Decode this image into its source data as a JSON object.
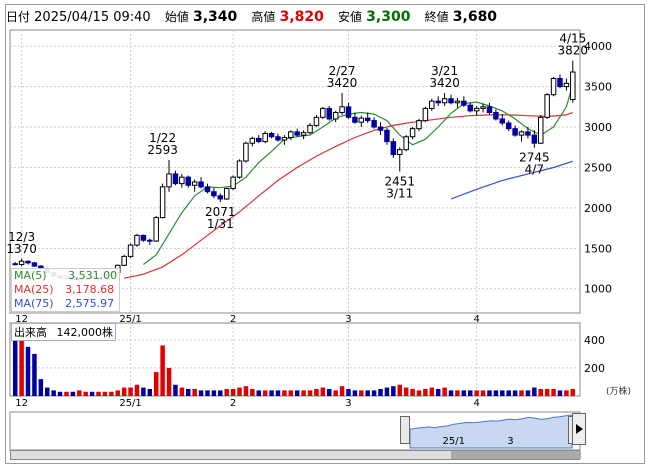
{
  "header": {
    "date_label": "日付",
    "date_value": "2025/04/15 09:40",
    "open_label": "始値",
    "open_value": "3,340",
    "high_label": "高値",
    "high_value": "3,820",
    "low_label": "安値",
    "low_value": "3,300",
    "close_label": "終値",
    "close_value": "3,680"
  },
  "legend": {
    "ma5_label": "MA(5)",
    "ma5_value": "3,531.00",
    "ma25_label": "MA(25)",
    "ma25_value": "3,178.68",
    "ma75_label": "MA(75)",
    "ma75_value": "2,575.97",
    "volume_label": "出来高",
    "volume_value": "142,000株",
    "volume_unit": "(万株)"
  },
  "colors": {
    "up": "#e00000",
    "down": "#0000a0",
    "ma5": "#2e8b2e",
    "ma25": "#e03030",
    "ma75": "#3050d0",
    "navigator_fill": "#c8d8f0",
    "navigator_line": "#4a78c8"
  },
  "chart_data": {
    "type": "candlestick",
    "price_axis": {
      "ylim": [
        700,
        4200
      ],
      "ticks": [
        "4000",
        "3500",
        "3000",
        "2500",
        "2000",
        "1500",
        "1000"
      ]
    },
    "volume_axis": {
      "ylim": [
        0,
        520
      ],
      "ticks": [
        "400",
        "200"
      ]
    },
    "x_labels": [
      {
        "i": 1,
        "label": "12"
      },
      {
        "i": 18,
        "label": "25/1"
      },
      {
        "i": 34,
        "label": "2"
      },
      {
        "i": 52,
        "label": "3"
      },
      {
        "i": 72,
        "label": "4"
      }
    ],
    "navigator_labels": [
      {
        "label": "25/1",
        "pos": 0.27
      },
      {
        "label": "3",
        "pos": 0.7
      }
    ],
    "annotations": [
      {
        "text": "12/3",
        "i": 1,
        "y": 1370,
        "anchor": "above"
      },
      {
        "text": "1370",
        "i": 1,
        "y": 1370,
        "anchor": "above2"
      },
      {
        "text": "1/22",
        "i": 23,
        "y": 2593,
        "anchor": "above"
      },
      {
        "text": "2593",
        "i": 23,
        "y": 2593,
        "anchor": "above2"
      },
      {
        "text": "2071",
        "i": 32,
        "y": 2071,
        "anchor": "below"
      },
      {
        "text": "1/31",
        "i": 32,
        "y": 2071,
        "anchor": "below2"
      },
      {
        "text": "2/27",
        "i": 51,
        "y": 3420,
        "anchor": "above"
      },
      {
        "text": "3420",
        "i": 51,
        "y": 3420,
        "anchor": "above2"
      },
      {
        "text": "2451",
        "i": 60,
        "y": 2451,
        "anchor": "below"
      },
      {
        "text": "3/11",
        "i": 60,
        "y": 2451,
        "anchor": "below2"
      },
      {
        "text": "3/21",
        "i": 67,
        "y": 3420,
        "anchor": "above"
      },
      {
        "text": "3420",
        "i": 67,
        "y": 3420,
        "anchor": "above2"
      },
      {
        "text": "2745",
        "i": 81,
        "y": 2745,
        "anchor": "below"
      },
      {
        "text": "4/7",
        "i": 81,
        "y": 2745,
        "anchor": "below2"
      },
      {
        "text": "4/15",
        "i": 87,
        "y": 3820,
        "anchor": "above"
      },
      {
        "text": "3820",
        "i": 87,
        "y": 3820,
        "anchor": "above2"
      }
    ],
    "candles": [
      [
        1310,
        1330,
        1290,
        1300
      ],
      [
        1300,
        1370,
        1280,
        1340
      ],
      [
        1340,
        1350,
        1300,
        1320
      ],
      [
        1320,
        1330,
        1270,
        1280
      ],
      [
        1280,
        1290,
        1230,
        1250
      ],
      [
        1250,
        1260,
        1190,
        1200
      ],
      [
        1200,
        1210,
        1150,
        1160
      ],
      [
        1160,
        1170,
        1120,
        1130
      ],
      [
        1130,
        1160,
        1110,
        1150
      ],
      [
        1150,
        1170,
        1100,
        1110
      ],
      [
        1110,
        1130,
        1080,
        1120
      ],
      [
        1120,
        1160,
        1100,
        1150
      ],
      [
        1150,
        1170,
        1120,
        1130
      ],
      [
        1130,
        1150,
        1100,
        1140
      ],
      [
        1140,
        1180,
        1120,
        1170
      ],
      [
        1170,
        1210,
        1150,
        1200
      ],
      [
        1200,
        1300,
        1190,
        1290
      ],
      [
        1290,
        1420,
        1280,
        1400
      ],
      [
        1400,
        1560,
        1380,
        1540
      ],
      [
        1540,
        1680,
        1520,
        1660
      ],
      [
        1660,
        1670,
        1580,
        1600
      ],
      [
        1600,
        1620,
        1540,
        1590
      ],
      [
        1590,
        1900,
        1580,
        1880
      ],
      [
        1880,
        2300,
        1870,
        2260
      ],
      [
        2260,
        2593,
        2200,
        2420
      ],
      [
        2420,
        2460,
        2280,
        2300
      ],
      [
        2300,
        2420,
        2250,
        2380
      ],
      [
        2380,
        2400,
        2250,
        2280
      ],
      [
        2280,
        2350,
        2200,
        2320
      ],
      [
        2320,
        2380,
        2240,
        2260
      ],
      [
        2260,
        2300,
        2180,
        2200
      ],
      [
        2200,
        2250,
        2120,
        2150
      ],
      [
        2150,
        2180,
        2071,
        2110
      ],
      [
        2110,
        2250,
        2100,
        2240
      ],
      [
        2240,
        2400,
        2220,
        2380
      ],
      [
        2380,
        2600,
        2360,
        2580
      ],
      [
        2580,
        2820,
        2560,
        2800
      ],
      [
        2800,
        2880,
        2760,
        2860
      ],
      [
        2860,
        2900,
        2800,
        2820
      ],
      [
        2820,
        2950,
        2800,
        2920
      ],
      [
        2920,
        2940,
        2860,
        2880
      ],
      [
        2880,
        2920,
        2820,
        2840
      ],
      [
        2840,
        2900,
        2780,
        2870
      ],
      [
        2870,
        2960,
        2840,
        2940
      ],
      [
        2940,
        2980,
        2880,
        2900
      ],
      [
        2900,
        2960,
        2850,
        2930
      ],
      [
        2930,
        3050,
        2910,
        3020
      ],
      [
        3020,
        3150,
        3000,
        3120
      ],
      [
        3120,
        3250,
        3100,
        3230
      ],
      [
        3230,
        3260,
        3080,
        3100
      ],
      [
        3100,
        3200,
        3060,
        3180
      ],
      [
        3180,
        3420,
        3150,
        3250
      ],
      [
        3250,
        3300,
        3100,
        3120
      ],
      [
        3120,
        3180,
        3040,
        3060
      ],
      [
        3060,
        3140,
        3000,
        3110
      ],
      [
        3110,
        3180,
        3050,
        3080
      ],
      [
        3080,
        3120,
        2980,
        3000
      ],
      [
        3000,
        3060,
        2900,
        2960
      ],
      [
        2960,
        2990,
        2780,
        2820
      ],
      [
        2820,
        2860,
        2620,
        2660
      ],
      [
        2660,
        2750,
        2451,
        2720
      ],
      [
        2720,
        2900,
        2700,
        2880
      ],
      [
        2880,
        3000,
        2850,
        2980
      ],
      [
        2980,
        3100,
        2950,
        3080
      ],
      [
        3080,
        3250,
        3060,
        3230
      ],
      [
        3230,
        3350,
        3200,
        3320
      ],
      [
        3320,
        3380,
        3260,
        3300
      ],
      [
        3300,
        3420,
        3260,
        3350
      ],
      [
        3350,
        3400,
        3280,
        3300
      ],
      [
        3300,
        3360,
        3240,
        3320
      ],
      [
        3320,
        3380,
        3250,
        3270
      ],
      [
        3270,
        3300,
        3180,
        3200
      ],
      [
        3200,
        3260,
        3140,
        3230
      ],
      [
        3230,
        3290,
        3180,
        3250
      ],
      [
        3250,
        3300,
        3150,
        3180
      ],
      [
        3180,
        3220,
        3080,
        3100
      ],
      [
        3100,
        3160,
        3020,
        3050
      ],
      [
        3050,
        3080,
        2950,
        2980
      ],
      [
        2980,
        3020,
        2880,
        2900
      ],
      [
        2900,
        2960,
        2820,
        2940
      ],
      [
        2940,
        3000,
        2860,
        2900
      ],
      [
        2900,
        2960,
        2745,
        2800
      ],
      [
        2800,
        3150,
        2790,
        3120
      ],
      [
        3120,
        3420,
        3100,
        3400
      ],
      [
        3400,
        3620,
        3380,
        3600
      ],
      [
        3600,
        3650,
        3480,
        3500
      ],
      [
        3500,
        3600,
        3450,
        3540
      ],
      [
        3340,
        3820,
        3300,
        3680
      ]
    ],
    "volume": [
      480,
      400,
      350,
      300,
      120,
      60,
      40,
      30,
      30,
      30,
      40,
      30,
      30,
      30,
      30,
      30,
      40,
      60,
      60,
      80,
      60,
      50,
      170,
      360,
      200,
      80,
      60,
      50,
      50,
      40,
      40,
      40,
      40,
      50,
      50,
      60,
      70,
      50,
      40,
      40,
      40,
      40,
      40,
      40,
      40,
      40,
      40,
      50,
      60,
      50,
      40,
      70,
      50,
      40,
      40,
      40,
      40,
      50,
      60,
      70,
      80,
      60,
      50,
      40,
      50,
      60,
      50,
      60,
      40,
      40,
      40,
      40,
      40,
      40,
      40,
      40,
      40,
      40,
      40,
      40,
      40,
      60,
      50,
      50,
      50,
      40,
      40,
      50
    ],
    "ma5": [
      [
        20,
        1300
      ],
      [
        22,
        1420
      ],
      [
        24,
        1680
      ],
      [
        26,
        1940
      ],
      [
        28,
        2150
      ],
      [
        30,
        2260
      ],
      [
        32,
        2250
      ],
      [
        34,
        2270
      ],
      [
        36,
        2380
      ],
      [
        38,
        2560
      ],
      [
        40,
        2700
      ],
      [
        42,
        2850
      ],
      [
        44,
        2880
      ],
      [
        46,
        2900
      ],
      [
        48,
        3000
      ],
      [
        50,
        3110
      ],
      [
        52,
        3160
      ],
      [
        54,
        3180
      ],
      [
        56,
        3160
      ],
      [
        58,
        3080
      ],
      [
        60,
        2900
      ],
      [
        62,
        2780
      ],
      [
        64,
        2850
      ],
      [
        66,
        3000
      ],
      [
        68,
        3170
      ],
      [
        70,
        3290
      ],
      [
        72,
        3310
      ],
      [
        74,
        3260
      ],
      [
        76,
        3200
      ],
      [
        78,
        3100
      ],
      [
        80,
        2980
      ],
      [
        82,
        2900
      ],
      [
        84,
        3000
      ],
      [
        86,
        3250
      ],
      [
        87,
        3531
      ]
    ],
    "ma25": [
      [
        17,
        1130
      ],
      [
        20,
        1180
      ],
      [
        23,
        1270
      ],
      [
        26,
        1420
      ],
      [
        29,
        1600
      ],
      [
        32,
        1780
      ],
      [
        35,
        1950
      ],
      [
        38,
        2150
      ],
      [
        41,
        2340
      ],
      [
        44,
        2500
      ],
      [
        47,
        2640
      ],
      [
        50,
        2760
      ],
      [
        53,
        2870
      ],
      [
        56,
        2960
      ],
      [
        59,
        3020
      ],
      [
        62,
        3060
      ],
      [
        65,
        3090
      ],
      [
        68,
        3120
      ],
      [
        71,
        3140
      ],
      [
        74,
        3150
      ],
      [
        77,
        3150
      ],
      [
        80,
        3140
      ],
      [
        83,
        3130
      ],
      [
        86,
        3150
      ],
      [
        87,
        3178.68
      ]
    ],
    "ma75": [
      [
        68,
        2110
      ],
      [
        72,
        2230
      ],
      [
        76,
        2340
      ],
      [
        80,
        2420
      ],
      [
        84,
        2500
      ],
      [
        87,
        2575.97
      ]
    ],
    "navigator_series": [
      0.55,
      0.58,
      0.6,
      0.62,
      0.6,
      0.63,
      0.65,
      0.7,
      0.72,
      0.75,
      0.74,
      0.76,
      0.78,
      0.8,
      0.79,
      0.82,
      0.85,
      0.83,
      0.86,
      0.9,
      0.88,
      0.84,
      0.86,
      0.9,
      0.92,
      0.95,
      0.97
    ]
  }
}
